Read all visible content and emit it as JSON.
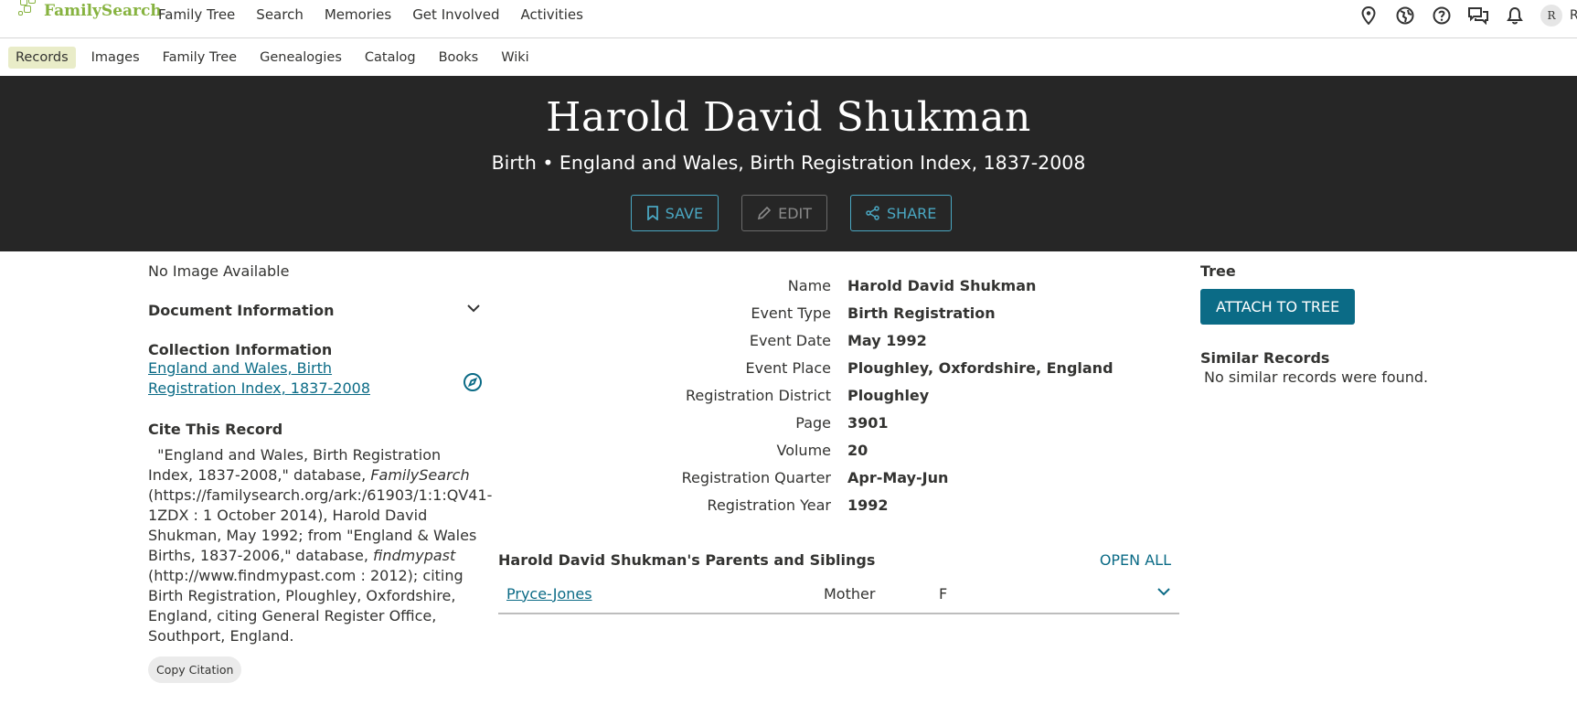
{
  "header": {
    "logo_text": "FamilySearch",
    "nav": [
      "Family Tree",
      "Search",
      "Memories",
      "Get Involved",
      "Activities"
    ],
    "avatar_initial": "R",
    "user_initial_cut": "R",
    "icons": [
      "location-pin-icon",
      "globe-icon",
      "help-icon",
      "messages-icon",
      "bell-icon"
    ]
  },
  "subnav": {
    "items": [
      "Records",
      "Images",
      "Family Tree",
      "Genealogies",
      "Catalog",
      "Books",
      "Wiki"
    ],
    "active": "Records"
  },
  "hero": {
    "name": "Harold David Shukman",
    "subtitle": "Birth • England and Wales, Birth Registration Index, 1837-2008",
    "save_label": "SAVE",
    "edit_label": "EDIT",
    "share_label": "SHARE"
  },
  "left": {
    "no_image": "No Image Available",
    "document_info": "Document Information",
    "collection_heading": "Collection Information",
    "collection_link": "England and Wales, Birth Registration Index, 1837-2008",
    "cite_heading": "Cite This Record",
    "cite_part1": "\"England and Wales, Birth Registration Index, 1837-2008,\" database, ",
    "cite_italic1": "FamilySearch",
    "cite_part2": " (https://familysearch.org/ark:/61903/1:1:QV41-1ZDX : 1 October 2014), Harold David Shukman, May 1992; from \"England & Wales Births, 1837-2006,\" database, ",
    "cite_italic2": "findmypast",
    "cite_part3": " (http://www.findmypast.com : 2012); citing Birth Registration, Ploughley, Oxfordshire, England, citing General Register Office, Southport, England.",
    "copy_label": "Copy Citation"
  },
  "facts": [
    {
      "label": "Name",
      "value": "Harold David Shukman"
    },
    {
      "label": "Event Type",
      "value": "Birth Registration"
    },
    {
      "label": "Event Date",
      "value": "May 1992"
    },
    {
      "label": "Event Place",
      "value": "Ploughley, Oxfordshire, England"
    },
    {
      "label": "Registration District",
      "value": "Ploughley"
    },
    {
      "label": "Page",
      "value": "3901"
    },
    {
      "label": "Volume",
      "value": "20"
    },
    {
      "label": "Registration Quarter",
      "value": "Apr-May-Jun"
    },
    {
      "label": "Registration Year",
      "value": "1992"
    }
  ],
  "relatives": {
    "heading": "Harold David Shukman's Parents and Siblings",
    "open_all": "OPEN ALL",
    "rows": [
      {
        "name": "Pryce-Jones",
        "role": "Mother",
        "sex": "F"
      }
    ]
  },
  "right": {
    "tree_heading": "Tree",
    "attach_label": "ATTACH TO TREE",
    "similar_heading": "Similar Records",
    "similar_text": "No similar records were found."
  },
  "colors": {
    "brand_green": "#87b340",
    "link_blue": "#0b6b86",
    "hero_bg": "#262626",
    "hero_button": "#4aa7c2",
    "active_tab_bg": "#e9ecc8"
  }
}
